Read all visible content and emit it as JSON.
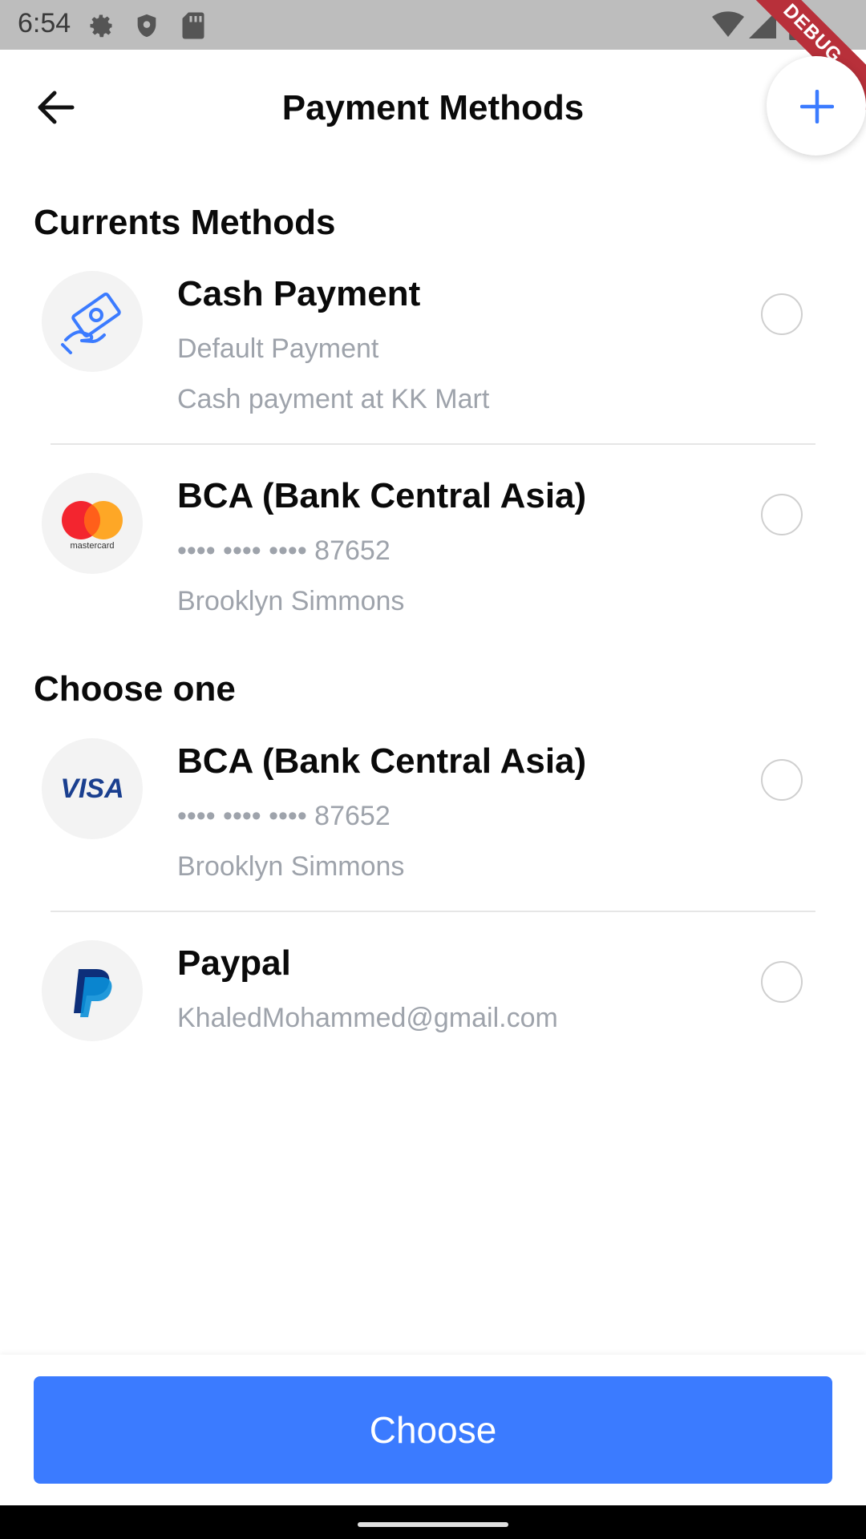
{
  "status_bar": {
    "time": "6:54",
    "debug_label": "DEBUG"
  },
  "app_bar": {
    "title": "Payment Methods",
    "accent_color": "#3b7bff"
  },
  "sections": {
    "current_title": "Currents Methods",
    "choose_title": "Choose one"
  },
  "current_methods": [
    {
      "title": "Cash Payment",
      "line1": "Default Payment",
      "line2": "Cash payment at KK Mart",
      "icon": "cash-icon"
    },
    {
      "title": "BCA (Bank Central Asia)",
      "line1": "•••• •••• •••• 87652",
      "line2": "Brooklyn Simmons",
      "icon": "mastercard-icon",
      "icon_text": "mastercard"
    }
  ],
  "choose_methods": [
    {
      "title": "BCA (Bank Central Asia)",
      "line1": "•••• •••• •••• 87652",
      "line2": "Brooklyn Simmons",
      "icon": "visa-icon",
      "icon_text": "VISA"
    },
    {
      "title": "Paypal",
      "line1": "KhaledMohammed@gmail.com",
      "icon": "paypal-icon"
    }
  ],
  "choose_button": {
    "label": "Choose"
  }
}
